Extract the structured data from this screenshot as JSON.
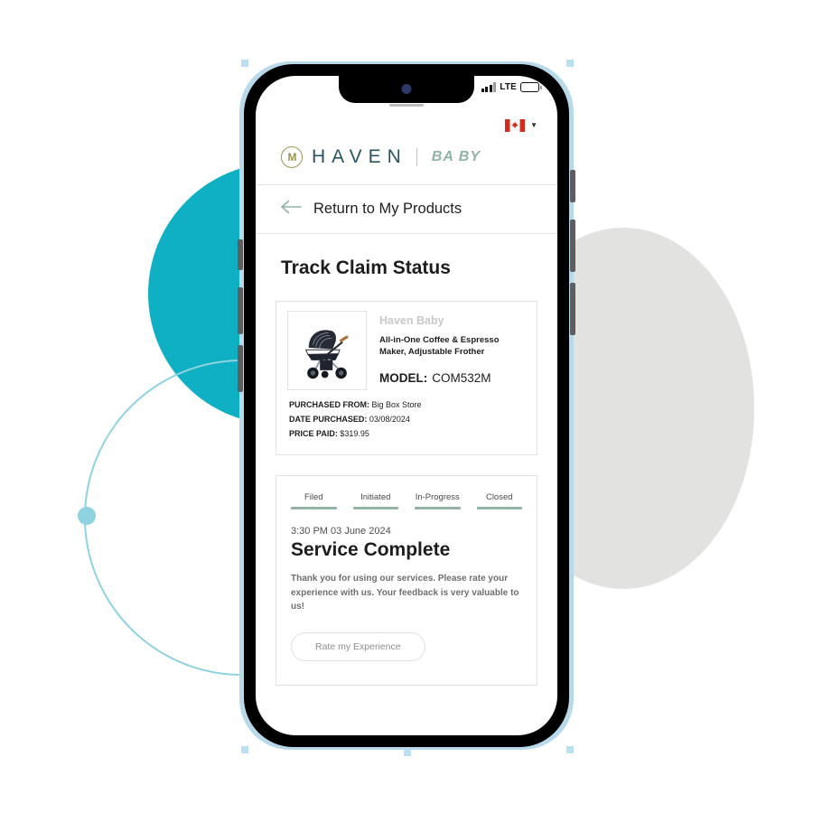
{
  "status_bar": {
    "network_label": "LTE",
    "signal_icon": "signal-bars-icon",
    "battery_icon": "battery-icon"
  },
  "locale": {
    "flag": "canada-flag-icon",
    "flag_label": "Canada",
    "chevron": "▼"
  },
  "brand": {
    "emblem": "M",
    "name": "HAVEN",
    "sub_name": "BA BY",
    "logo_gold": "#9b9350",
    "logo_teal": "#2a5560",
    "logo_sage": "#8fb3a6"
  },
  "nav": {
    "back_icon": "arrow-left-icon",
    "back_label": "Return to My Products"
  },
  "page": {
    "title": "Track Claim Status"
  },
  "product": {
    "thumbnail_icon": "stroller-product-image",
    "brand": "Haven Baby",
    "name": "All-in-One Coffee & Espresso Maker, Adjustable Frother",
    "model_label": "MODEL:",
    "model_value": "COM532M",
    "details": [
      {
        "label": "PURCHASED FROM:",
        "value": "Big Box Store"
      },
      {
        "label": "DATE PURCHASED:",
        "value": "03/08/2024"
      },
      {
        "label": "PRICE PAID:",
        "value": "$319.95"
      }
    ]
  },
  "claim_status": {
    "tabs": [
      {
        "label": "Filed"
      },
      {
        "label": "Initiated"
      },
      {
        "label": "In-Progress"
      },
      {
        "label": "Closed"
      }
    ],
    "tab_accent": "#93b4a3",
    "timestamp": "3:30 PM 03 June 2024",
    "heading": "Service Complete",
    "body": "Thank you for using our services. Please rate your experience with us. Your feedback is very valuable to us!",
    "rate_button": "Rate my Experience"
  },
  "decor": {
    "teal": "#10b0c4",
    "grey": "#e2e2e0",
    "light_blue": "#8fd2e0"
  }
}
